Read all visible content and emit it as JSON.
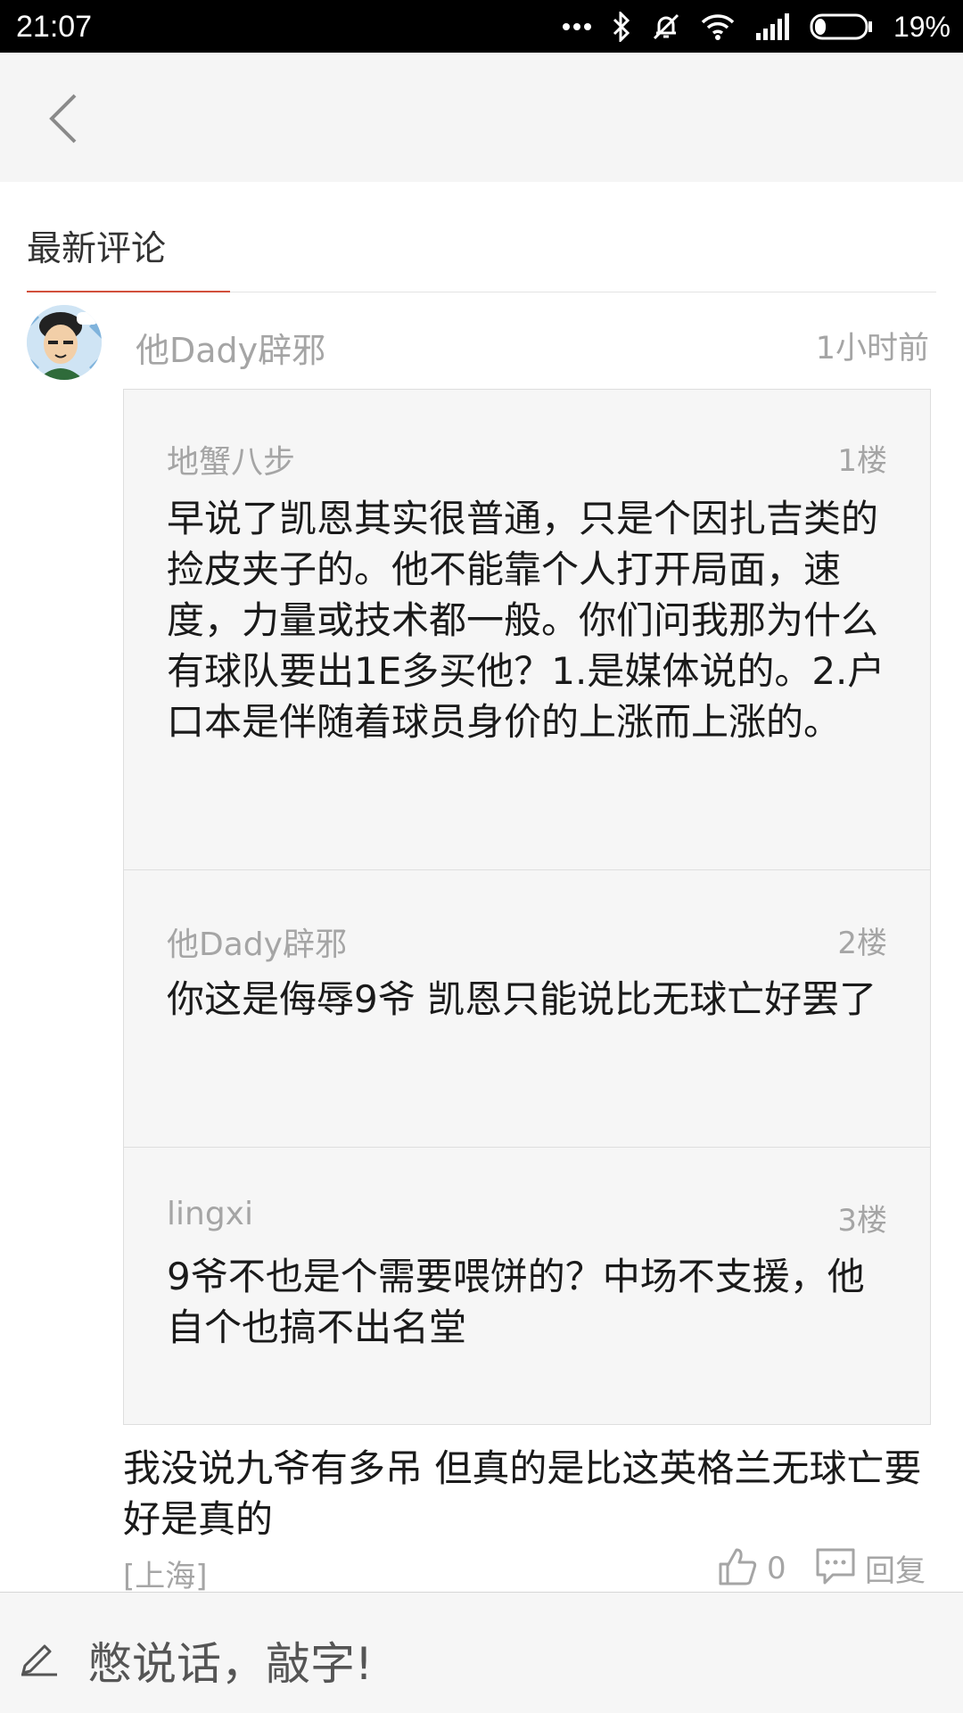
{
  "status_bar": {
    "time": "21:07",
    "battery_percent": "19%",
    "icons": [
      "more-dots-icon",
      "bluetooth-icon",
      "mute-icon",
      "wifi-icon",
      "signal-icon",
      "battery-icon"
    ]
  },
  "nav": {
    "back_icon": "chevron-left-icon"
  },
  "section": {
    "title": "最新评论",
    "accent_color": "#d2503c"
  },
  "comment": {
    "user": "他Dady辟邪",
    "time": "1小时前",
    "quotes": [
      {
        "user": "地蟹八步",
        "floor": "1楼",
        "text": "早说了凯恩其实很普通，只是个因扎吉类的捡皮夹子的。他不能靠个人打开局面，速度，力量或技术都一般。你们问我那为什么有球队要出1E多买他？1.是媒体说的。2.户口本是伴随着球员身价的上涨而上涨的。"
      },
      {
        "user": "他Dady辟邪",
        "floor": "2楼",
        "text": "你这是侮辱9爷 凯恩只能说比无球亡好罢了"
      },
      {
        "user": "lingxi",
        "floor": "3楼",
        "text": "9爷不也是个需要喂饼的？中场不支援，他自个也搞不出名堂"
      }
    ],
    "text": "我没说九爷有多吊 但真的是比这英格兰无球亡要好是真的",
    "location": "[上海]",
    "likes": "0",
    "reply_label": "回复"
  },
  "input": {
    "placeholder": "憋说话，敲字!"
  }
}
